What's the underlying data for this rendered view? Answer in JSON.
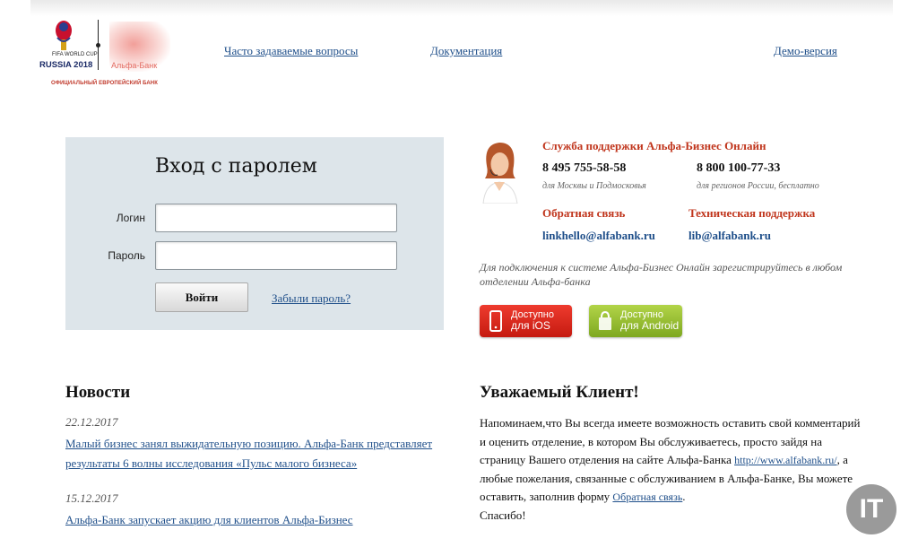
{
  "logo": {
    "fifa_small": "FIFA WORLD CUP",
    "fifa_text": "RUSSIA 2018",
    "bank_name": "Альфа-Банк",
    "sub": "ОФИЦИАЛЬНЫЙ ЕВРОПЕЙСКИЙ БАНК"
  },
  "nav": {
    "faq": "Часто задаваемые вопросы",
    "docs": "Документация",
    "demo": "Демо-версия"
  },
  "login": {
    "title": "Вход с паролем",
    "login_label": "Логин",
    "password_label": "Пароль",
    "login_value": "",
    "password_value": "",
    "submit": "Войти",
    "forgot": "Забыли пароль?"
  },
  "support": {
    "title": "Служба поддержки Альфа-Бизнес Онлайн",
    "phone_moscow": "8 495 755-58-58",
    "phone_moscow_note": "для Москвы и Подмосковья",
    "phone_regions": "8 800 100-77-33",
    "phone_regions_note": "для регионов России, бесплатно",
    "feedback_title": "Обратная связь",
    "feedback_email": "linkhello@alfabank.ru",
    "tech_title": "Техническая поддержка",
    "tech_email": "lib@alfabank.ru",
    "connect_note": "Для подключения к системе Альфа-Бизнес Онлайн зарегистрируйтесь в любом отделении Альфа-банка"
  },
  "stores": {
    "ios_line1": "Доступно",
    "ios_line2": "для iOS",
    "android_line1": "Доступно",
    "android_line2": "для Android",
    "ios_color": "#d9241a",
    "android_color": "#98c033"
  },
  "news": {
    "title": "Новости",
    "items": [
      {
        "date": "22.12.2017",
        "text": "Малый бизнес занял выжидательную позицию. Альфа-Банк представляет результаты 6 волны исследования «Пульс малого бизнеса»"
      },
      {
        "date": "15.12.2017",
        "text": "Альфа-Банк запускает акцию для клиентов Альфа-Бизнес"
      }
    ]
  },
  "client": {
    "title": "Уважаемый Клиент!",
    "text_1": "Напоминаем,что Вы всегда имеете возможность оставить свой комментарий и оценить отделение, в котором Вы обслуживаетесь, просто зайдя на страницу Вашего отделения на сайте Альфа-Банка ",
    "site_link": "http://www.alfabank.ru/",
    "text_2": ", а любые пожелания, связанные с обслуживанием в Альфа-Банке, Вы можете оставить, заполнив форму ",
    "feedback_link": "Обратная связь",
    "text_3": ".",
    "thanks": "Спасибо!"
  },
  "badge": {
    "text": "IT"
  },
  "colors": {
    "accent_red": "#c0351c",
    "link_blue": "#1f4f8a",
    "panel_bg": "#dde5ea"
  }
}
